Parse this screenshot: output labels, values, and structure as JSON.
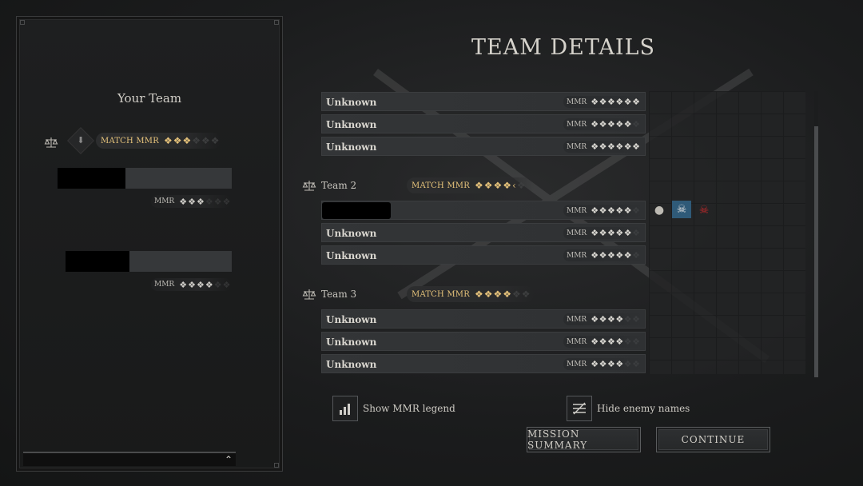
{
  "left_panel": {
    "title": "Your Team",
    "match_mmr_label": "MATCH MMR",
    "match_mmr_stars": 3,
    "players": [
      {
        "mmr_label": "MMR",
        "stars": 3
      },
      {
        "mmr_label": "MMR",
        "stars": 4
      }
    ]
  },
  "header": {
    "title": "TEAM DETAILS"
  },
  "teams": [
    {
      "name": "",
      "players": [
        {
          "name": "Unknown",
          "mmr_label": "MMR",
          "stars": 6
        },
        {
          "name": "Unknown",
          "mmr_label": "MMR",
          "stars": 5
        },
        {
          "name": "Unknown",
          "mmr_label": "MMR",
          "stars": 6
        }
      ]
    },
    {
      "name": "Team 2",
      "match_mmr_label": "MATCH MMR",
      "match_mmr_stars": 4.5,
      "players": [
        {
          "name": "",
          "mmr_label": "MMR",
          "stars": 5,
          "redacted": true
        },
        {
          "name": "Unknown",
          "mmr_label": "MMR",
          "stars": 5
        },
        {
          "name": "Unknown",
          "mmr_label": "MMR",
          "stars": 5
        }
      ]
    },
    {
      "name": "Team 3",
      "match_mmr_label": "MATCH MMR",
      "match_mmr_stars": 4,
      "players": [
        {
          "name": "Unknown",
          "mmr_label": "MMR",
          "stars": 4
        },
        {
          "name": "Unknown",
          "mmr_label": "MMR",
          "stars": 4
        },
        {
          "name": "Unknown",
          "mmr_label": "MMR",
          "stars": 4
        }
      ]
    }
  ],
  "status_icons": [
    "crosshair-skull-icon",
    "skull-icon",
    "red-skull-icon"
  ],
  "options": {
    "show_mmr_legend": "Show MMR legend",
    "hide_enemy_names": "Hide enemy names"
  },
  "buttons": {
    "mission_summary": "MISSION SUMMARY",
    "continue": "CONTINUE"
  },
  "colors": {
    "accent_gold": "#e5c27a",
    "danger_red": "#c0292b",
    "highlight_blue": "#2f5a78"
  }
}
